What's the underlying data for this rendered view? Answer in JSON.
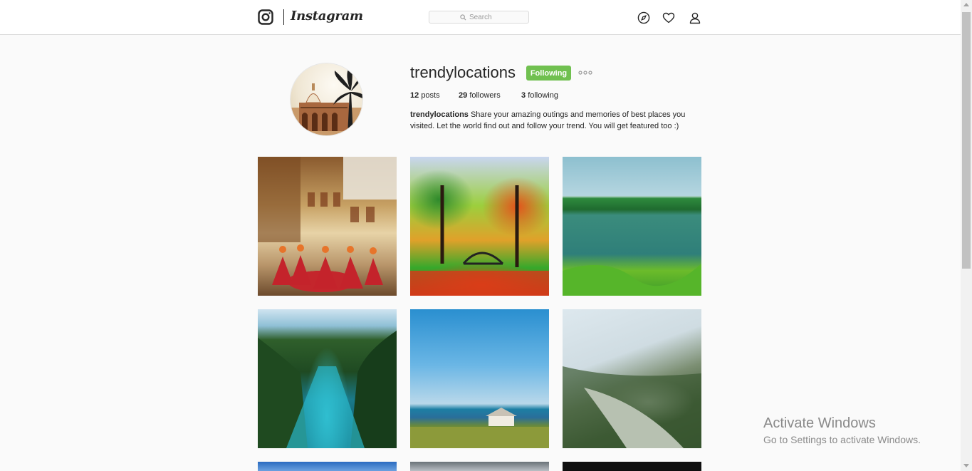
{
  "header": {
    "brand": "Instagram",
    "search": {
      "placeholder": "Search",
      "value": ""
    },
    "icons": [
      "compass-icon",
      "heart-icon",
      "person-icon"
    ]
  },
  "profile": {
    "username": "trendylocations",
    "follow_button": "Following",
    "follow_button_color": "#70c050",
    "stats": {
      "posts_count": "12",
      "posts_label": "posts",
      "followers_count": "29",
      "followers_label": "followers",
      "following_count": "3",
      "following_label": "following"
    },
    "bio": {
      "name": "trendylocations",
      "text": "Share your amazing outings and memories of best places you visited. Let the world find out and follow your trend. You will get featured too :)"
    }
  },
  "watermark": {
    "title": "Activate Windows",
    "subtitle": "Go to Settings to activate Windows."
  }
}
